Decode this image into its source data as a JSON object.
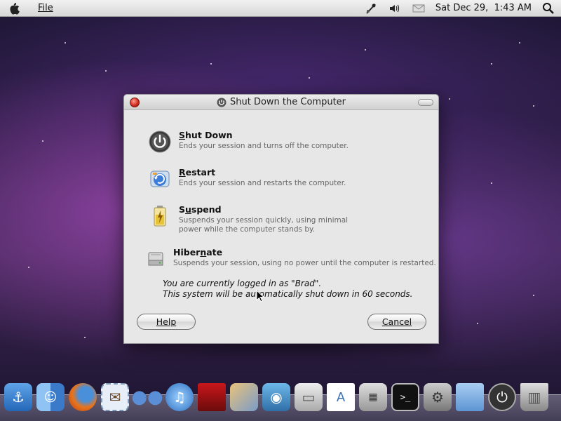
{
  "menubar": {
    "apple_icon": "apple-logo-icon",
    "file_label": "File",
    "clock": "Sat Dec 29,  1:43 AM",
    "icons": [
      "network-icon",
      "volume-icon",
      "mail-icon",
      "spotlight-search-icon"
    ]
  },
  "dialog": {
    "title": "Shut Down the Computer",
    "options": [
      {
        "key": "shutdown",
        "label": "Shut Down",
        "mnemonic": "S",
        "rest": "hut Down",
        "description": "Ends your session and turns off the computer.",
        "icon": "power-icon"
      },
      {
        "key": "restart",
        "label": "Restart",
        "mnemonic": "R",
        "rest": "estart",
        "description": "Ends your session and restarts the computer.",
        "icon": "restart-icon"
      },
      {
        "key": "suspend",
        "label": "Suspend",
        "mnemonic": "u",
        "pre": "S",
        "rest": "spend",
        "description_line1": "Suspends your session quickly, using minimal",
        "description_line2": "power while the computer stands by.",
        "icon": "battery-icon"
      },
      {
        "key": "hibernate",
        "label": "Hibernate",
        "pre": "Hiber",
        "mnemonic": "n",
        "rest": "ate",
        "description": "Suspends your session, using no power until the computer is restarted.",
        "icon": "hard-drive-icon"
      }
    ],
    "notice_line1": "You are currently logged in as \"Brad\".",
    "notice_line2": "This system will be automatically shut down in 60 seconds.",
    "help_label": "Help",
    "cancel_label": "Cancel"
  },
  "dock": {
    "items": [
      "anchor-icon",
      "finder-icon",
      "firefox-icon",
      "mail-stamp-icon",
      "people-icon",
      "itunes-icon",
      "photo-booth-icon",
      "photos-icon",
      "camera-icon",
      "scanner-icon",
      "text-edit-icon",
      "calculator-icon",
      "terminal-icon",
      "system-preferences-icon",
      "folder-icon",
      "power-icon",
      "trash-icon"
    ]
  },
  "colors": {
    "dialog_bg": "#e7e7e7",
    "close_red": "#d0261a",
    "desktop_purple": "#3c2552"
  }
}
